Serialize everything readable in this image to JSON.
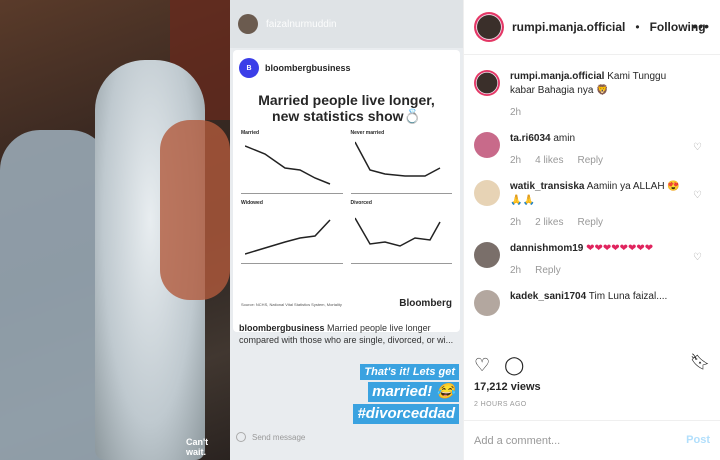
{
  "left": {
    "photo_caption": "Can't wait.",
    "story_user": "faizalnurmuddin",
    "bloomberg": {
      "name": "bloombergbusiness",
      "logo_text": "B",
      "infographic_title": "Married people live longer, new statistics show💍",
      "panels": [
        "Married",
        "Never married",
        "Widowed",
        "Divorced"
      ],
      "footer_logo": "Bloomberg",
      "source_text": "Source: NCHS, National Vital Statistics System, Mortality",
      "caption_user": "bloombergbusiness",
      "caption_text": "Married people live longer compared with those who are single, divorced, or wi..."
    },
    "sticker": {
      "line1": "That's it! Lets get",
      "line2": "married! 😂",
      "line3": "#divorceddad"
    },
    "reply_placeholder": "Send message"
  },
  "header": {
    "username": "rumpi.manja.official",
    "dot": "•",
    "follow_label": "Following",
    "more_icon": "more-icon"
  },
  "caption": {
    "username": "rumpi.manja.official",
    "text": "Kami Tunggu kabar Bahagia nya 🦁",
    "time": "2h"
  },
  "comments": [
    {
      "user": "ta.ri6034",
      "text": "amin",
      "time": "2h",
      "likes": "4 likes",
      "reply": "Reply"
    },
    {
      "user": "watik_transiska",
      "text": "Aamiin ya ALLAH 😍🙏🙏",
      "time": "2h",
      "likes": "2 likes",
      "reply": "Reply"
    },
    {
      "user": "dannishmom19",
      "text": "❤❤❤❤❤❤❤❤",
      "time": "2h",
      "likes": "",
      "reply": "Reply"
    },
    {
      "user": "kadek_sani1704",
      "text": "Tim Luna faizal....",
      "time": "",
      "likes": "",
      "reply": ""
    }
  ],
  "stats": {
    "views": "17,212 views",
    "ago": "2 HOURS AGO"
  },
  "add_comment": {
    "placeholder": "Add a comment...",
    "post_label": "Post"
  },
  "colors": {
    "accent_blue": "#3897f0",
    "post_disabled": "#b2dffc",
    "sticker_blue": "#3aa2e0"
  }
}
